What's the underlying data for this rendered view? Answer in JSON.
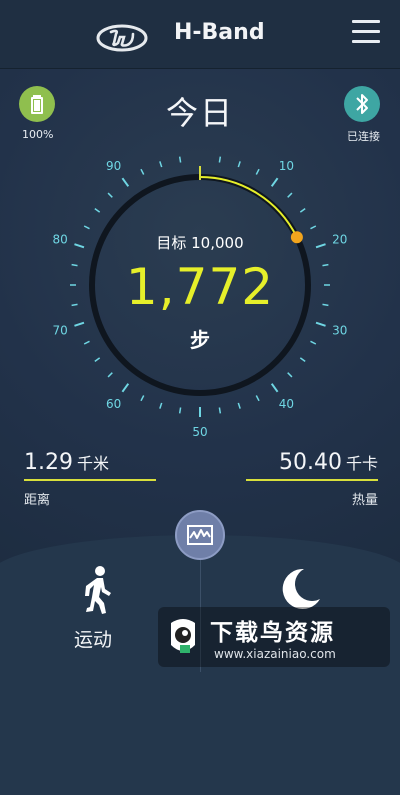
{
  "header": {
    "title": "H-Band",
    "logo_icon": "hyundai-logo-icon",
    "menu_icon": "hamburger-menu-icon"
  },
  "status": {
    "battery_label": "100%",
    "battery_icon": "battery-icon",
    "bluetooth_label": "已连接",
    "bluetooth_icon": "bluetooth-icon",
    "battery_color": "#8fbf4e",
    "bluetooth_color": "#3ea6a3"
  },
  "day": {
    "title": "今日"
  },
  "gauge": {
    "goal_label": "目标 10,000",
    "steps": "1,772",
    "steps_unit": "步",
    "tick_labels": [
      "10",
      "20",
      "30",
      "40",
      "50",
      "60",
      "70",
      "80",
      "90"
    ],
    "progress": 0.1772,
    "accent_color": "#e6ef2a",
    "tick_color": "#6fd6e3"
  },
  "stats": {
    "distance": {
      "value": "1.29",
      "unit": "千米",
      "caption": "距离"
    },
    "calories": {
      "value": "50.40",
      "unit": "千卡",
      "caption": "热量"
    },
    "line_color": "#d8df3c"
  },
  "bottom": {
    "chart_button_icon": "chart-wave-icon",
    "motion_icon": "walking-person-icon",
    "motion_label": "运动",
    "sleep_icon": "moon-icon"
  },
  "watermark": {
    "title": "下载鸟资源",
    "url": "www.xiazainiao.com",
    "icon": "bird-logo-icon"
  }
}
